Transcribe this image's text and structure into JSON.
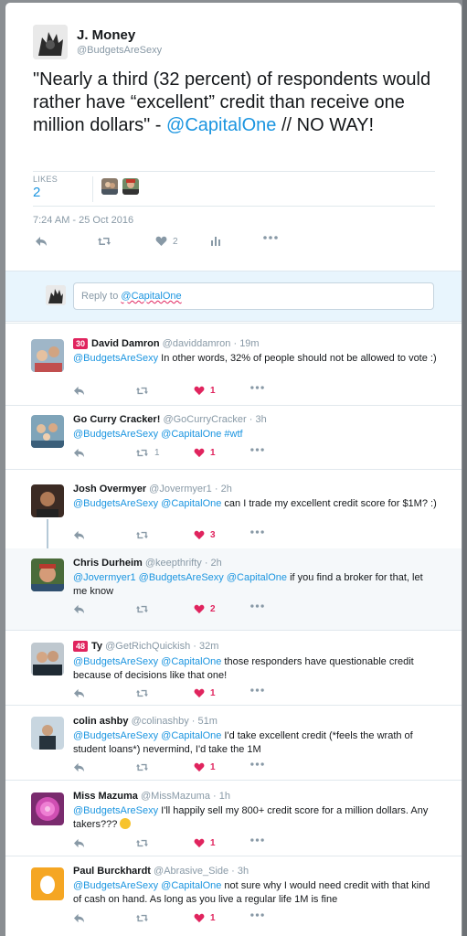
{
  "tweet": {
    "name": "J. Money",
    "handle": "@BudgetsAreSexy",
    "text_before": "\"Nearly a third (32 percent) of respondents would rather have “excellent” credit than receive one million dollars\" - ",
    "text_mention": "@CapitalOne",
    "text_after": " // NO WAY!",
    "likes_label": "LIKES",
    "likes_count": "2",
    "timestamp": "7:24 AM - 25 Oct 2016",
    "like_action_count": "2"
  },
  "reply_box": {
    "prefix": "Reply to ",
    "mention": "@CapitalOne"
  },
  "replies": [
    {
      "badge": "30",
      "name": "David Damron",
      "handle": "@daviddamron · 19m",
      "mentions": "@BudgetsAreSexy",
      "text": " In other words, 32% of people should not be allowed to vote :)",
      "retweets": "",
      "likes": "1"
    },
    {
      "badge": "",
      "name": "Go Curry Cracker!",
      "handle": "@GoCurryCracker · 3h",
      "mentions": "@BudgetsAreSexy @CapitalOne #wtf",
      "text": "",
      "retweets": "1",
      "likes": "1"
    },
    {
      "badge": "",
      "name": "Josh Overmyer",
      "handle": "@Jovermyer1 · 2h",
      "mentions": "@BudgetsAreSexy @CapitalOne",
      "text": " can I trade my excellent credit score for $1M? :)",
      "retweets": "",
      "likes": "3"
    },
    {
      "badge": "",
      "name": "Chris Durheim",
      "handle": "@keepthrifty · 2h",
      "mentions": "@Jovermyer1 @BudgetsAreSexy @CapitalOne",
      "text": " if you find a broker for that, let me know",
      "retweets": "",
      "likes": "2"
    },
    {
      "badge": "48",
      "name": "Ty",
      "handle": "@GetRichQuickish · 32m",
      "mentions": "@BudgetsAreSexy @CapitalOne",
      "text": " those responders have questionable credit because of decisions like that one!",
      "retweets": "",
      "likes": "1"
    },
    {
      "badge": "",
      "name": "colin ashby",
      "handle": "@colinashby · 51m",
      "mentions": "@BudgetsAreSexy @CapitalOne",
      "text": " I'd take excellent credit (*feels the wrath of student loans*) nevermind, I'd take the 1M",
      "retweets": "",
      "likes": "1"
    },
    {
      "badge": "",
      "name": "Miss Mazuma",
      "handle": "@MissMazuma · 1h",
      "mentions": "@BudgetsAreSexy",
      "text": " I'll happily sell my 800+ credit score for a million dollars. Any takers???",
      "retweets": "",
      "likes": "1"
    },
    {
      "badge": "",
      "name": "Paul Burckhardt",
      "handle": "@Abrasive_Side · 3h",
      "mentions": "@BudgetsAreSexy @CapitalOne",
      "text": "  not sure why I would need credit with that kind of cash on hand.  As long as you live a regular life 1M is fine",
      "retweets": "",
      "likes": "1"
    }
  ],
  "colors": {
    "link": "#1b95e0",
    "heart": "#e0245e",
    "muted": "#8899a6"
  }
}
